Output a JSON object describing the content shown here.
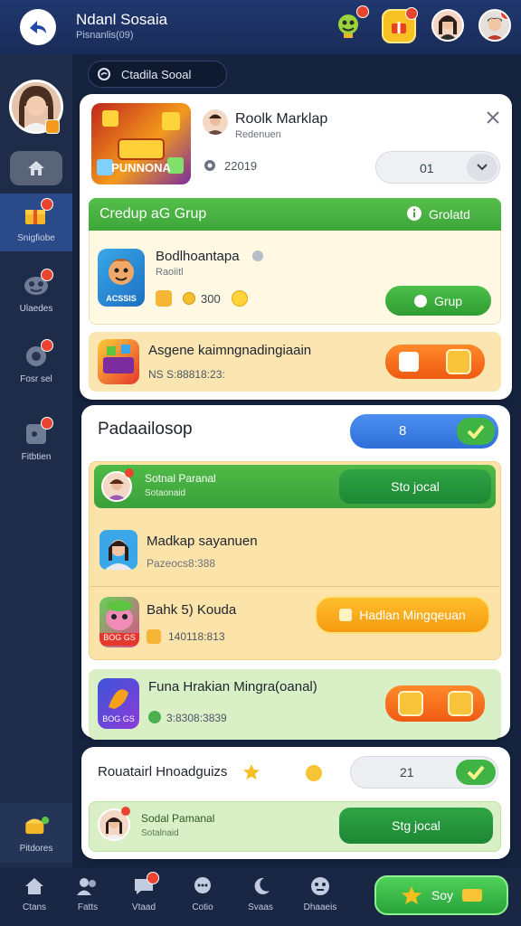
{
  "header": {
    "title": "Ndanl Sosaia",
    "subtitle": "Pisnanlis(09)",
    "icons": [
      "logo-icon",
      "trophy-icon",
      "gift-icon"
    ]
  },
  "sidebar": {
    "items": [
      {
        "label": "Snigfiobe",
        "icon": "gift-icon",
        "active": true
      },
      {
        "label": "Ulaedes",
        "icon": "mask-icon"
      },
      {
        "label": "Fosr sel",
        "icon": "chat-icon"
      },
      {
        "label": "Fitbtien",
        "icon": "flag-icon"
      }
    ],
    "bottom_item": {
      "label": "Pitdores",
      "icon": "treasure-icon"
    }
  },
  "search": {
    "label": "Ctadila Sooal"
  },
  "top_card": {
    "user_name": "Roolk Marklap",
    "user_sub": "Redenuen",
    "game_banner_text": "PUNNONA",
    "stat": "22019",
    "selector_value": "01",
    "group": {
      "header": "Credup aG Grup",
      "header_right": "Grolatd",
      "item_title": "Bodlhoantapa",
      "item_sub": "Raoiitl",
      "item_score": "300",
      "item_thumb_text": "ACSSIS",
      "join_button": "Grup"
    },
    "invite": {
      "title": "Asgene kaimngnadingiaain",
      "code": "NS S:88818:23:"
    }
  },
  "social_card": {
    "title": "Padaailosop",
    "toggle_value": "8",
    "rows": [
      {
        "name": "Sotnal Paranal",
        "sub": "Sotaonaid",
        "button": "Sto jocal"
      },
      {
        "name": "Madkap sayanuen",
        "sub": "Pazeocs8:388"
      },
      {
        "name": "Bahk 5) Kouda",
        "sub": "140118:813",
        "thumb_text": "BOG GS",
        "button": "Hadlan Mingqeuan"
      }
    ],
    "feature": {
      "title": "Funa Hrakian Mingra(oanal)",
      "sub": "3:8308:3839",
      "thumb_text": "BOG GS"
    }
  },
  "bottom_card": {
    "title": "Rouatairl Hnoadguizs",
    "toggle_value": "21",
    "row": {
      "name": "Sodal Pamanal",
      "sub": "Sotalnaid",
      "button": "Stg jocal"
    }
  },
  "bottom_nav": {
    "items": [
      "Ctans",
      "Fatts",
      "Vtaad",
      "Cotio",
      "Svaas",
      "Dhaaeis"
    ],
    "play_label": "Soy"
  },
  "colors": {
    "accent_green": "#3cb446",
    "accent_orange": "#f2651a",
    "nav_bg": "#1a2744"
  }
}
